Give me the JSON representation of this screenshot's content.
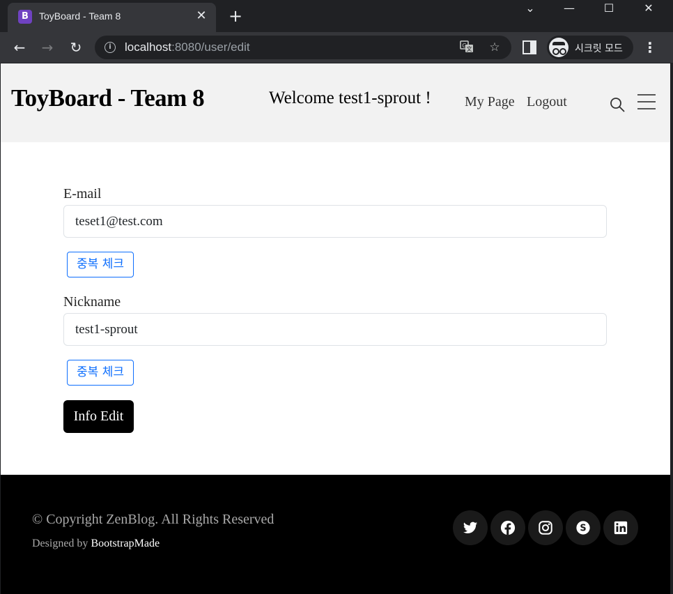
{
  "browser": {
    "tab_title": "ToyBoard - Team 8",
    "tab_favicon_letter": "B",
    "tab_close": "✕",
    "new_tab": "+",
    "window_controls": {
      "chevron": "⌄",
      "minimize": "—",
      "maximize": "☐",
      "close": "✕"
    },
    "url_host": "localhost",
    "url_path": ":8080/user/edit",
    "incognito_label": "시크릿 모드"
  },
  "header": {
    "brand": "ToyBoard - Team 8",
    "welcome": "Welcome test1-sprout !",
    "nav": [
      {
        "label": "My Page"
      },
      {
        "label": "Logout"
      }
    ]
  },
  "form": {
    "email_label": "E-mail",
    "email_value": "teset1@test.com",
    "email_check_label": "중복 체크",
    "nickname_label": "Nickname",
    "nickname_value": "test1-sprout",
    "nickname_check_label": "중복 체크",
    "submit_label": "Info Edit"
  },
  "footer": {
    "copyright": "© Copyright ZenBlog. All Rights Reserved",
    "designed_prefix": "Designed by ",
    "designed_brand": "BootstrapMade",
    "social": [
      "twitter-icon",
      "facebook-icon",
      "instagram-icon",
      "skype-icon",
      "linkedin-icon"
    ]
  },
  "colors": {
    "header_bg": "#f2f2f2",
    "footer_bg": "#000000",
    "primary_outline": "#0d6efd",
    "submit_bg": "#000000"
  }
}
